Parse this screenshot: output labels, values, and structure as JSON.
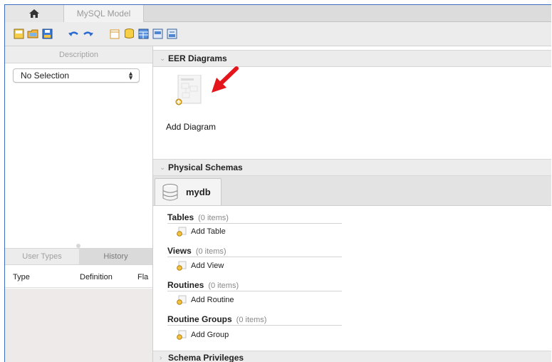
{
  "tabs": {
    "model_tab": "MySQL Model"
  },
  "toolbar": {
    "buttons": [
      "new-model-icon",
      "open-model-icon",
      "save-model-icon",
      "undo-icon",
      "redo-icon",
      "toggle-grid-icon",
      "add-schema-icon",
      "add-table-icon",
      "add-view-icon",
      "add-routine-icon"
    ]
  },
  "left_panel": {
    "header": "Description",
    "selector_value": "No Selection",
    "subtabs": [
      "User Types",
      "History"
    ],
    "columns": [
      "Type",
      "Definition",
      "Fla"
    ]
  },
  "eer": {
    "section_title": "EER Diagrams",
    "add_label": "Add Diagram",
    "accent_color": "#e4161b"
  },
  "physical": {
    "section_title": "Physical Schemas",
    "schema_name": "mydb",
    "categories": [
      {
        "name": "Tables",
        "count": "(0 items)",
        "add_label": "Add Table"
      },
      {
        "name": "Views",
        "count": "(0 items)",
        "add_label": "Add View"
      },
      {
        "name": "Routines",
        "count": "(0 items)",
        "add_label": "Add Routine"
      },
      {
        "name": "Routine Groups",
        "count": "(0 items)",
        "add_label": "Add Group"
      }
    ]
  },
  "privileges": {
    "section_title": "Schema Privileges"
  }
}
